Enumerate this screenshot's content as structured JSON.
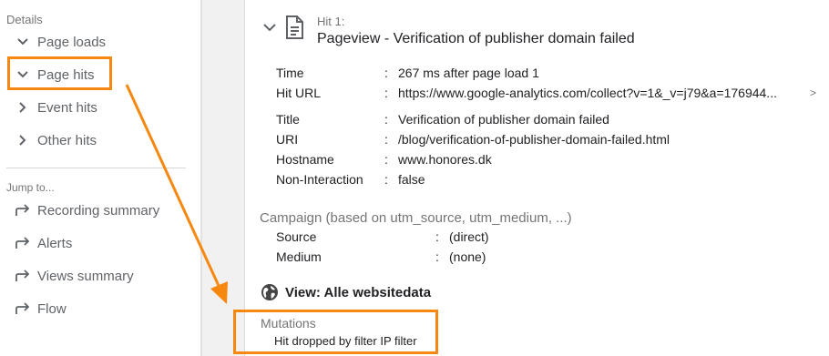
{
  "sidebar": {
    "details_heading": "Details",
    "details_items": [
      {
        "label": "Page loads",
        "icon": "chevron-down-icon"
      },
      {
        "label": "Page hits",
        "icon": "chevron-down-icon"
      },
      {
        "label": "Event hits",
        "icon": "chevron-right-icon"
      },
      {
        "label": "Other hits",
        "icon": "chevron-right-icon"
      }
    ],
    "jump_heading": "Jump to...",
    "jump_items": [
      {
        "label": "Recording summary",
        "icon": "jump-arrow-icon"
      },
      {
        "label": "Alerts",
        "icon": "jump-arrow-icon"
      },
      {
        "label": "Views summary",
        "icon": "jump-arrow-icon"
      },
      {
        "label": "Flow",
        "icon": "jump-arrow-icon"
      }
    ]
  },
  "hit": {
    "number": "Hit 1:",
    "title": "Pageview - Verification of publisher domain failed",
    "fields_group1": [
      {
        "label": "Time",
        "value": "267 ms after page load 1"
      },
      {
        "label": "Hit URL",
        "value": "https://www.google-analytics.com/collect?v=1&_v=j79&a=176944..."
      }
    ],
    "fields_group2": [
      {
        "label": "Title",
        "value": "Verification of publisher domain failed"
      },
      {
        "label": "URI",
        "value": "/blog/verification-of-publisher-domain-failed.html"
      },
      {
        "label": "Hostname",
        "value": "www.honores.dk"
      },
      {
        "label": "Non-Interaction",
        "value": "false"
      }
    ],
    "colon": ":",
    "expand_arrow": ">"
  },
  "campaign": {
    "heading": "Campaign (based on utm_source, utm_medium, ...)",
    "fields": [
      {
        "label": "Source",
        "value": "(direct)"
      },
      {
        "label": "Medium",
        "value": "(none)"
      }
    ]
  },
  "view": {
    "label": "View: Alle websitedata",
    "icon": "globe-icon"
  },
  "mutations": {
    "heading": "Mutations",
    "text": "Hit dropped by filter IP filter"
  },
  "colors": {
    "annotation": "#f7880f",
    "muted_text": "#757575",
    "body_text": "#202124",
    "nav_text": "#5f6368"
  }
}
